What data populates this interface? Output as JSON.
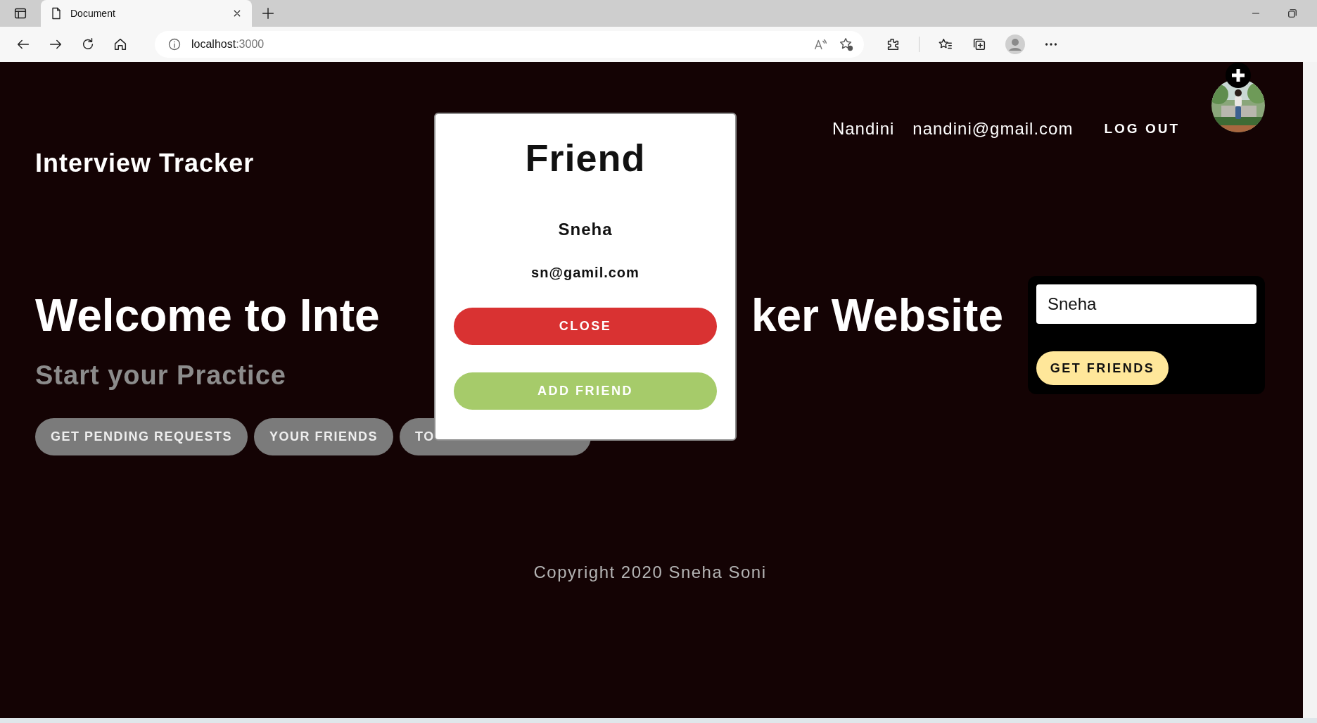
{
  "browser": {
    "tab_title": "Document",
    "address": {
      "host": "localhost",
      "port": ":3000"
    }
  },
  "header": {
    "brand": "Interview Tracker",
    "user_name": "Nandini",
    "user_email": "nandini@gmail.com",
    "logout": "LOG OUT"
  },
  "hero": {
    "heading_parts": [
      "Welcome to Inte",
      "ker Website"
    ],
    "subtitle": "Start your Practice",
    "buttons": [
      "GET PENDING REQUESTS",
      "YOUR FRIENDS",
      "TO"
    ]
  },
  "search": {
    "value": "Sneha",
    "button": "GET FRIENDS"
  },
  "footer": "Copyright 2020 Sneha Soni",
  "modal": {
    "title": "Friend",
    "name": "Sneha",
    "email": "sn@gamil.com",
    "buttons": [
      {
        "label": "CLOSE",
        "kind": "close"
      },
      {
        "label": "ADD FRIEND",
        "kind": "add"
      }
    ]
  }
}
